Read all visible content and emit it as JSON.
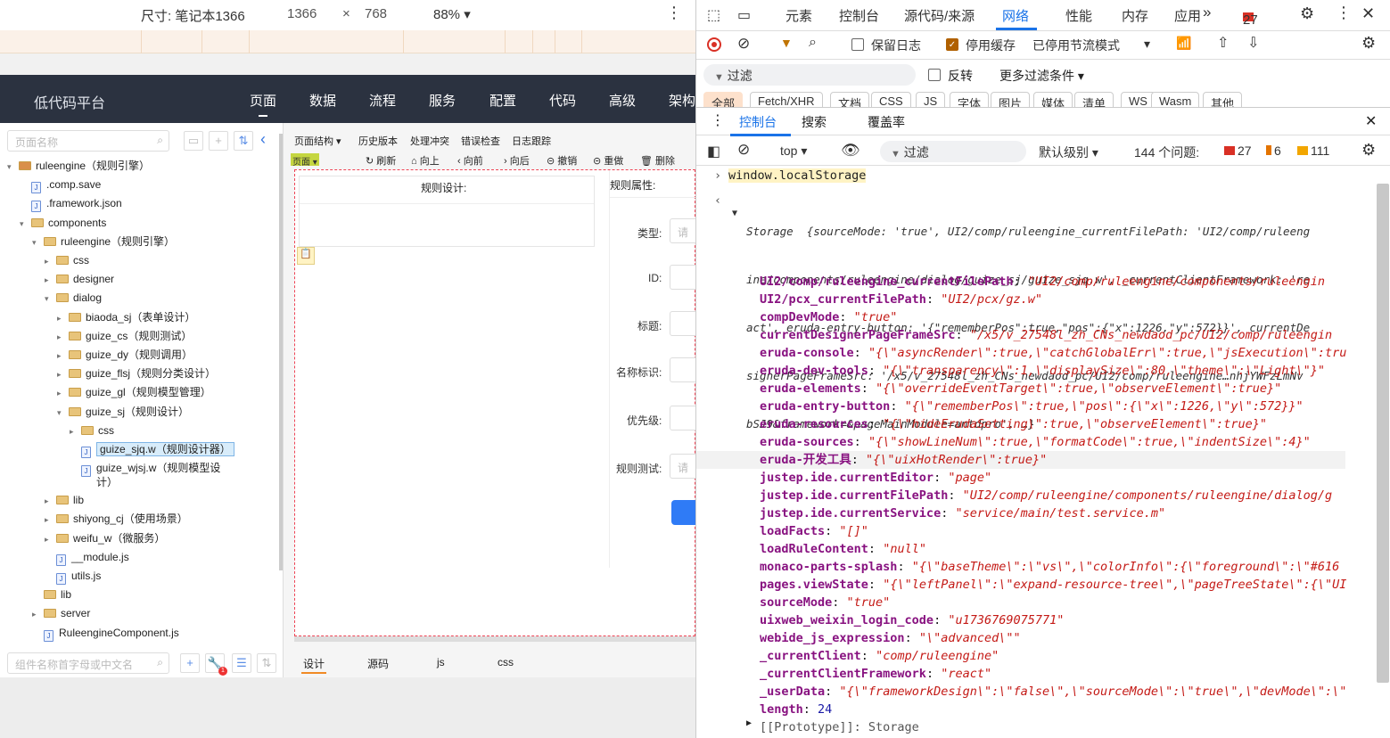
{
  "devbar": {
    "size_label": "尺寸: 笔记本1366",
    "width": "1366",
    "times": "×",
    "height": "768",
    "zoom": "88%"
  },
  "app": {
    "logo": "低代码平台",
    "menu": [
      "页面",
      "数据",
      "流程",
      "服务",
      "配置",
      "代码",
      "高级",
      "架构"
    ],
    "tree_search_placeholder": "页面名称",
    "tree": [
      {
        "label": "ruleengine（规则引擎）",
        "kind": "root",
        "indent": 0,
        "arrow": "▾"
      },
      {
        "label": ".comp.save",
        "kind": "file",
        "indent": 1,
        "arrow": ""
      },
      {
        "label": ".framework.json",
        "kind": "file",
        "indent": 1,
        "arrow": ""
      },
      {
        "label": "components",
        "kind": "folder",
        "indent": 1,
        "arrow": "▾"
      },
      {
        "label": "ruleengine（规则引擎）",
        "kind": "folder",
        "indent": 2,
        "arrow": "▾"
      },
      {
        "label": "css",
        "kind": "folder",
        "indent": 3,
        "arrow": "▸"
      },
      {
        "label": "designer",
        "kind": "folder",
        "indent": 3,
        "arrow": "▸"
      },
      {
        "label": "dialog",
        "kind": "folder",
        "indent": 3,
        "arrow": "▾"
      },
      {
        "label": "biaoda_sj（表单设计）",
        "kind": "folder",
        "indent": 4,
        "arrow": "▸"
      },
      {
        "label": "guize_cs（规则测试）",
        "kind": "folder",
        "indent": 4,
        "arrow": "▸"
      },
      {
        "label": "guize_dy（规则调用）",
        "kind": "folder",
        "indent": 4,
        "arrow": "▸"
      },
      {
        "label": "guize_flsj（规则分类设计）",
        "kind": "folder",
        "indent": 4,
        "arrow": "▸"
      },
      {
        "label": "guize_gl（规则模型管理）",
        "kind": "folder",
        "indent": 4,
        "arrow": "▸"
      },
      {
        "label": "guize_sj（规则设计）",
        "kind": "folder",
        "indent": 4,
        "arrow": "▾"
      },
      {
        "label": "css",
        "kind": "folder",
        "indent": 5,
        "arrow": "▸"
      },
      {
        "label": "guize_sjq.w（规则设计器）",
        "kind": "file",
        "indent": 5,
        "arrow": "",
        "selected": true
      },
      {
        "label": "guize_wjsj.w（规则模型设计）",
        "kind": "file",
        "indent": 5,
        "arrow": "",
        "double": true
      },
      {
        "label": "lib",
        "kind": "folder",
        "indent": 3,
        "arrow": "▸"
      },
      {
        "label": "shiyong_cj（使用场景）",
        "kind": "folder",
        "indent": 3,
        "arrow": "▸"
      },
      {
        "label": "weifu_w（微服务）",
        "kind": "folder",
        "indent": 3,
        "arrow": "▸"
      },
      {
        "label": "__module.js",
        "kind": "file",
        "indent": 3,
        "arrow": ""
      },
      {
        "label": "utils.js",
        "kind": "file",
        "indent": 3,
        "arrow": ""
      },
      {
        "label": "lib",
        "kind": "folder",
        "indent": 2,
        "arrow": ""
      },
      {
        "label": "server",
        "kind": "folder",
        "indent": 2,
        "arrow": "▸"
      },
      {
        "label": "RuleengineComponent.js",
        "kind": "file",
        "indent": 2,
        "arrow": ""
      }
    ],
    "comp_search_placeholder": "组件名称首字母或中文名",
    "design_tabs": [
      "页面结构 ▾",
      "历史版本",
      "处理冲突",
      "错误检查",
      "日志跟踪"
    ],
    "toolbar": [
      "刷新",
      "向上",
      "向前",
      "向后",
      "撤销",
      "重做",
      "删除"
    ],
    "page_tag": "页面",
    "rule_design_label": "规则设计:",
    "rule_attr_label": "规则属性:",
    "form_labels": [
      "类型:",
      "ID:",
      "标题:",
      "名称标识:",
      "优先级:",
      "规则测试:"
    ],
    "form_placeholder": "请",
    "bottom_tabs": [
      "设计",
      "源码",
      "js",
      "css"
    ]
  },
  "devtools": {
    "main_tabs": [
      "元素",
      "控制台",
      "源代码/来源",
      "网络",
      "性能",
      "内存",
      "应用"
    ],
    "active_tab": "网络",
    "error_count": "27",
    "net_row": {
      "preserve_log": "保留日志",
      "disable_cache": "停用缓存",
      "throttle": "已停用节流模式"
    },
    "filter_label": "过滤",
    "invert_label": "反转",
    "more_filters": "更多过滤条件 ▾",
    "chips": [
      "全部",
      "Fetch/XHR",
      "文档",
      "CSS",
      "JS",
      "字体",
      "图片",
      "媒体",
      "清单",
      "WS",
      "Wasm",
      "其他"
    ],
    "drawer_tabs": [
      "控制台",
      "搜索",
      "覆盖率"
    ],
    "context": "top",
    "console_filter": "过滤",
    "level": "默认级别",
    "issues": "144 个问题:",
    "issue_errors": "27",
    "issue_warnings": "6",
    "issue_info": "111",
    "command": "window.localStorage",
    "storage_line1": "Storage  {sourceMode: 'true', UI2/comp/ruleengine_currentFilePath: 'UI2/comp/ruleeng",
    "storage_line2": "ine/components/ruleengine/dialog/guize_sj/guize_sjq.w', _currentClientFramework: 're",
    "storage_line3": "act', eruda-entry-button: '{\"rememberPos\":true,\"pos\":{\"x\":1226,\"y\":572}}', currentDe",
    "storage_line4": "signerPageFrameSrc: '/x5/v_27548l_zh_CNs_newdaod_pc/UI2/comp/ruleengine…nhjYWFzLmNv",
    "storage_line5": "bSJ9&framework=&pageMainModule=antdpro', …}",
    "entries": [
      {
        "k": "UI2/comp/ruleengine_currentFilePath",
        "v": "\"UI2/comp/ruleengine/components/ruleengin"
      },
      {
        "k": "UI2/pcx_currentFilePath",
        "v": "\"UI2/pcx/gz.w\""
      },
      {
        "k": "compDevMode",
        "v": "\"true\""
      },
      {
        "k": "currentDesignerPageFrameSrc",
        "v": "\"/x5/v_27548l_zh_CNs_newdaod_pc/UI2/comp/ruleengin"
      },
      {
        "k": "eruda-console",
        "v": "\"{\\\"asyncRender\\\":true,\\\"catchGlobalErr\\\":true,\\\"jsExecution\\\":tru"
      },
      {
        "k": "eruda-dev-tools",
        "v": "\"{\\\"transparency\\\":1,\\\"displaySize\\\":80,\\\"theme\\\":\\\"Light\\\"}\""
      },
      {
        "k": "eruda-elements",
        "v": "\"{\\\"overrideEventTarget\\\":true,\\\"observeElement\\\":true}\""
      },
      {
        "k": "eruda-entry-button",
        "v": "\"{\\\"rememberPos\\\":true,\\\"pos\\\":{\\\"x\\\":1226,\\\"y\\\":572}}\""
      },
      {
        "k": "eruda-resources",
        "v": "\"{\\\"hideErudaSetting\\\":true,\\\"observeElement\\\":true}\""
      },
      {
        "k": "eruda-sources",
        "v": "\"{\\\"showLineNum\\\":true,\\\"formatCode\\\":true,\\\"indentSize\\\":4}\""
      },
      {
        "k": "eruda-开发工具",
        "v": "\"{\\\"uixHotRender\\\":true}\"",
        "hl": true
      },
      {
        "k": "justep.ide.currentEditor",
        "v": "\"page\""
      },
      {
        "k": "justep.ide.currentFilePath",
        "v": "\"UI2/comp/ruleengine/components/ruleengine/dialog/g"
      },
      {
        "k": "justep.ide.currentService",
        "v": "\"service/main/test.service.m\""
      },
      {
        "k": "loadFacts",
        "v": "\"[]\""
      },
      {
        "k": "loadRuleContent",
        "v": "\"null\""
      },
      {
        "k": "monaco-parts-splash",
        "v": "\"{\\\"baseTheme\\\":\\\"vs\\\",\\\"colorInfo\\\":{\\\"foreground\\\":\\\"#616"
      },
      {
        "k": "pages.viewState",
        "v": "\"{\\\"leftPanel\\\":\\\"expand-resource-tree\\\",\\\"pageTreeState\\\":{\\\"UI"
      },
      {
        "k": "sourceMode",
        "v": "\"true\""
      },
      {
        "k": "uixweb_weixin_login_code",
        "v": "\"u1736769075771\""
      },
      {
        "k": "webide_js_expression",
        "v": "\"\\\"advanced\\\"\""
      },
      {
        "k": "_currentClient",
        "v": "\"comp/ruleengine\""
      },
      {
        "k": "_currentClientFramework",
        "v": "\"react\""
      },
      {
        "k": "_userData",
        "v": "\"{\\\"frameworkDesign\\\":\\\"false\\\",\\\"sourceMode\\\":\\\"true\\\",\\\"devMode\\\":\\\""
      },
      {
        "k": "length",
        "v": "24",
        "num": true
      }
    ],
    "prototype": "[[Prototype]]: Storage"
  }
}
